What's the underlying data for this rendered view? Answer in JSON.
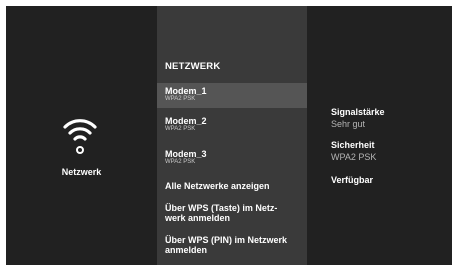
{
  "left": {
    "label": "Netzwerk",
    "icon": "wifi-icon"
  },
  "menu": {
    "title": "NETZWERK",
    "networks": [
      {
        "name": "Modem_1",
        "security": "WPA2 PSK"
      },
      {
        "name": "Modem_2",
        "security": "WPA2 PSK"
      },
      {
        "name": "Modem_3",
        "security": "WPA2 PSK"
      }
    ],
    "show_all": "Alle Netzwerke anzeigen",
    "wps_button_line1": "Über WPS (Taste) im Netz-",
    "wps_button_line2": "werk anmelden",
    "wps_pin_line1": "Über WPS (PIN) im Netzwerk",
    "wps_pin_line2": "anmelden"
  },
  "details": {
    "signal_label": "Signalstärke",
    "signal_value": "Sehr gut",
    "security_label": "Sicherheit",
    "security_value": "WPA2 PSK",
    "status_label": "Verfügbar"
  },
  "colors": {
    "background": "#212121",
    "menu_panel": "#3a3a3a",
    "selected_item": "#555555",
    "text": "#ffffff",
    "secondary_text": "#b4b4b4"
  }
}
